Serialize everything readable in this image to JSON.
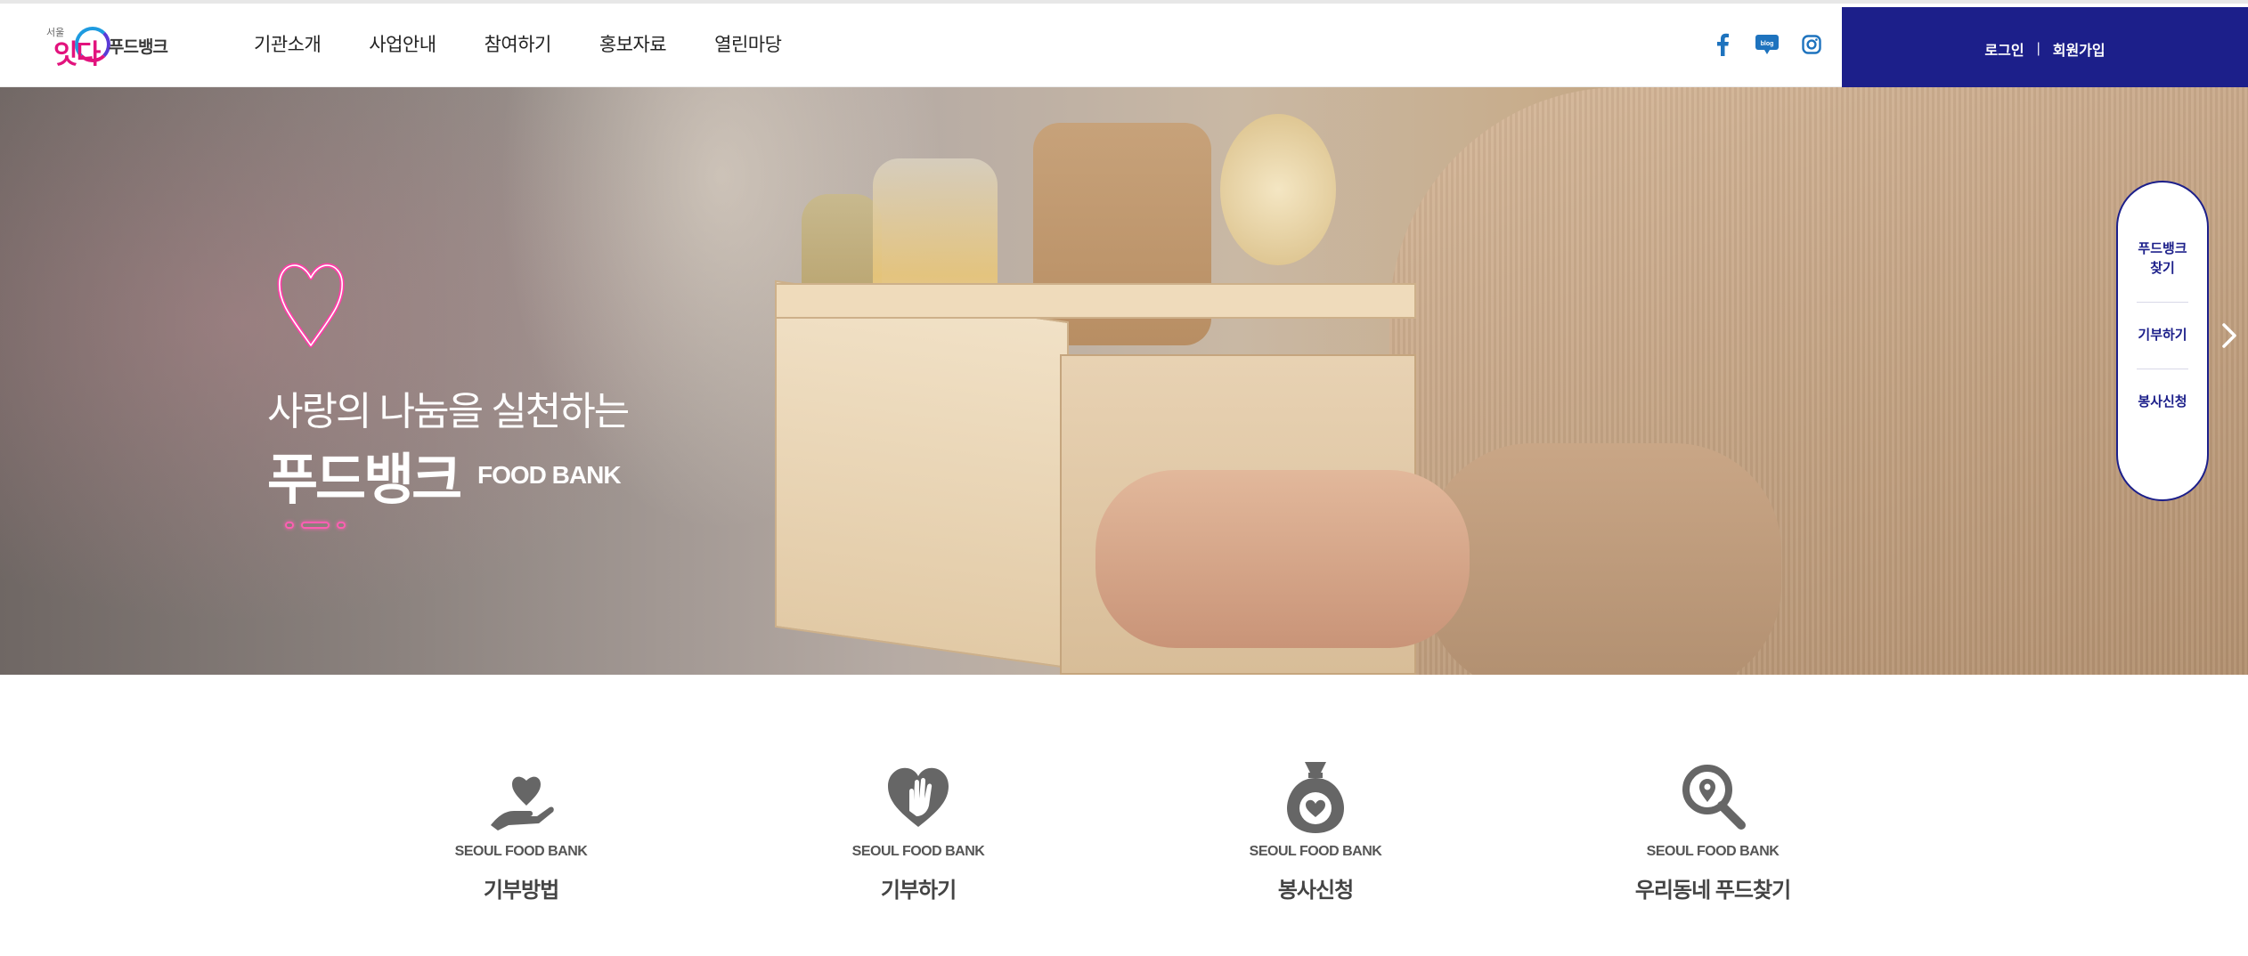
{
  "header": {
    "logo": {
      "small_text": "서울",
      "main_text": "잇다",
      "brand_text": "푸드뱅크"
    },
    "nav": [
      "기관소개",
      "사업안내",
      "참여하기",
      "홍보자료",
      "열린마당"
    ],
    "social": [
      {
        "name": "facebook",
        "icon": "facebook-icon",
        "label": "f"
      },
      {
        "name": "blog",
        "icon": "blog-icon",
        "label": "blog"
      },
      {
        "name": "instagram",
        "icon": "instagram-icon"
      }
    ],
    "auth": {
      "login": "로그인",
      "separator": "|",
      "signup": "회원가입"
    },
    "colors": {
      "auth_bg": "#1c1f8a",
      "accent_pink": "#e2137d",
      "accent_blue": "#1e9be0"
    }
  },
  "hero": {
    "subtitle": "사랑의 나눔을 실천하는",
    "title": "푸드뱅크",
    "title_en": "FOOD BANK"
  },
  "quick_menu": {
    "items": [
      "푸드뱅크\n찾기",
      "기부하기",
      "봉사신청"
    ],
    "next_icon": "chevron-right-icon"
  },
  "links": [
    {
      "en": "SEOUL FOOD BANK",
      "ko": "기부방법",
      "icon": "heart-hand-icon"
    },
    {
      "en": "SEOUL FOOD BANK",
      "ko": "기부하기",
      "icon": "heart-give-icon"
    },
    {
      "en": "SEOUL FOOD BANK",
      "ko": "봉사신청",
      "icon": "money-bag-heart-icon"
    },
    {
      "en": "SEOUL FOOD BANK",
      "ko": "우리동네 푸드찾기",
      "icon": "search-location-icon"
    }
  ]
}
